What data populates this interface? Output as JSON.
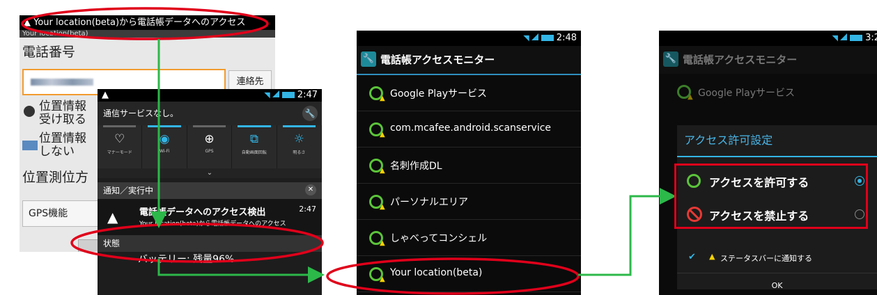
{
  "panel1": {
    "status_text": "▲ Your location(beta)から電話帳データへのアクセス",
    "title_bar": "Your location(beta)",
    "label_phone": "電話番号",
    "contact_button": "連絡先",
    "opt1_line1": "位置情報",
    "opt1_line2": "受け取る",
    "opt2_line1": "位置情報",
    "opt2_line2": "しない",
    "label_method": "位置測位方",
    "select_value": "GPS機能"
  },
  "panel2": {
    "time": "2:47",
    "header": "通信サービスなし。",
    "quick_settings": [
      {
        "icon": "♡",
        "label": "マナーモード",
        "on": false
      },
      {
        "icon": "◉",
        "label": "Wi-Fi",
        "on": true
      },
      {
        "icon": "⊕",
        "label": "GPS",
        "on": false
      },
      {
        "icon": "⧉",
        "label": "自動画面回転",
        "on": true
      },
      {
        "icon": "☼",
        "label": "明るさ",
        "on": true
      }
    ],
    "section_notify": "通知／実行中",
    "notif_title": "電話帳データへのアクセス検出",
    "notif_body": "Your location(beta)から電話帳データへのアクセス",
    "notif_time": "2:47",
    "section_status": "状態",
    "battery": "バッテリー: 残量96%"
  },
  "panel3": {
    "time": "2:48",
    "title": "電話帳アクセスモニター",
    "apps": [
      "Google Playサービス",
      "com.mcafee.android.scanservice",
      "名刺作成DL",
      "パーソナルエリア",
      "しゃべってコンシェル",
      "Your location(beta)"
    ]
  },
  "panel4": {
    "time": "3:2",
    "title": "電話帳アクセスモニター",
    "bg_app": "Google Playサービス",
    "dialog_title": "アクセス許可設定",
    "option_allow": "アクセスを許可する",
    "option_deny": "アクセスを禁止する",
    "checkbox_label": "ステータスバーに通知する",
    "ok_button": "OK"
  },
  "colors": {
    "accent_blue": "#33b5e5",
    "highlight_red": "#e0001a",
    "arrow_green": "#2db84a",
    "ring_green": "#5bc43a"
  }
}
